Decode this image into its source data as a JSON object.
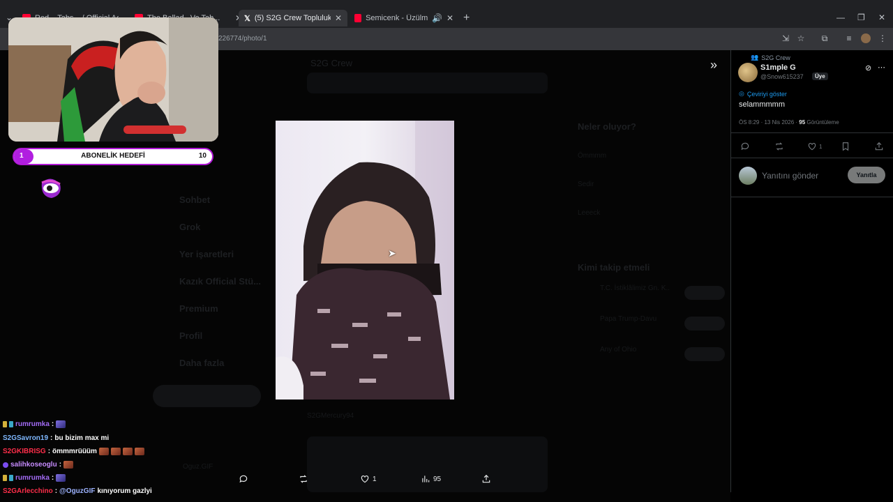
{
  "browser": {
    "tabs": [
      {
        "title": "Red... Tabs... / Official Acc...",
        "color": "#ff0033"
      },
      {
        "title": "The Ballad.. Vo Tab...",
        "color": "#ff0033"
      },
      {
        "title": "(5) S2G Crew Topluluk / X",
        "color": "#ffffff",
        "active": true
      },
      {
        "title": "Semicenk - Üzülmedim Ki (",
        "color": "#ff0033"
      }
    ],
    "url": "226774/photo/1"
  },
  "photo_actions": {
    "likes": "1",
    "views": "95"
  },
  "post": {
    "community": "S2G Crew",
    "author_name": "S1mple G",
    "author_handle": "@Snow615237",
    "badge": "Üye",
    "translate": "Çeviriyi göster",
    "text": "selammmmm",
    "time": "ÖS 8:29 · 13 Nis 2026 ·",
    "views_count": "95",
    "views_label": "Görüntüleme",
    "likes": "1",
    "reply_placeholder": "Yanıtını gönder",
    "reply_button": "Yanıtla"
  },
  "overlay": {
    "goal_label": "ABONELİK HEDEFİ",
    "goal_current": "1",
    "goal_target": "10",
    "goal_progress": 0.1
  },
  "chat": [
    {
      "user": "rumrumka",
      "color": "#a46cf7",
      "badge": "#d4b13a",
      "text": "",
      "emote": "blue"
    },
    {
      "user": "S2GSavron19",
      "color": "#7fb8ff",
      "badge": "",
      "text": "bu bizim max mi"
    },
    {
      "user": "S2GKIBRISG",
      "color": "#ff2e4a",
      "badge": "",
      "text": "ömmmrüüüm",
      "emote": "red4"
    },
    {
      "user": "salihkoseoglu",
      "color": "#c78cff",
      "badge": "#7a4df0",
      "text": "",
      "emote": "red"
    },
    {
      "user": "rumrumka",
      "color": "#a46cf7",
      "badge": "#d4b13a",
      "text": "",
      "emote": "blue"
    },
    {
      "user": "S2GArlecchino",
      "color": "#ff2e4a",
      "badge": "",
      "mention": "@OguzGIF",
      "text": "kınıyorum gazlyi"
    }
  ],
  "dim_page": {
    "header": "S2G Crew",
    "nav": [
      "Sohbet",
      "Grok",
      "Yer işaretleri",
      "Kazık Official Stü...",
      "Premium",
      "Profil",
      "Daha fazla"
    ],
    "post_button": "Gönderi yayınla",
    "trending_title": "Neler oluyor?",
    "trends": [
      "Ömmmm",
      "Sedir",
      "Leeeck"
    ],
    "follow_title": "Kimi takip etmeli",
    "follow": [
      "T.C. İstiklâlimiz Gn. K..",
      "Papa Trump-Davu",
      "Any of Ohio"
    ],
    "follow_button": "Takip et",
    "reply_user": "S2GMercury94",
    "footer_user": "Oguz.GIF"
  }
}
